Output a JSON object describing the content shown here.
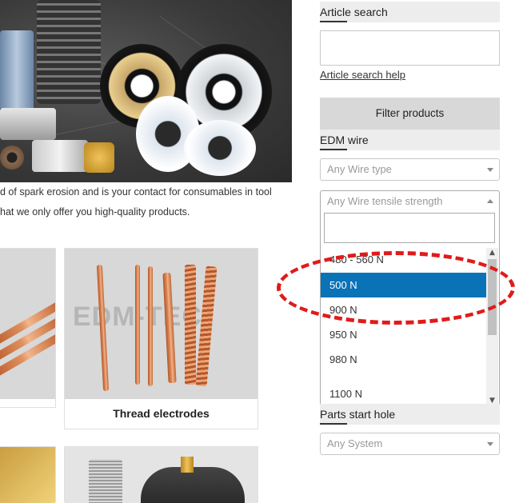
{
  "intro": {
    "line1": "d of spark erosion and is your contact for consumables in tool",
    "line2": "hat we only offer you high-quality products."
  },
  "cards": {
    "thread_electrodes": {
      "caption": "Thread electrodes",
      "watermark": "EDM-TEC"
    }
  },
  "sidebar": {
    "article_search": {
      "title": "Article search",
      "help_link": "Article search help"
    },
    "filter_button": "Filter products",
    "edm_wire": {
      "title": "EDM wire",
      "wire_type_placeholder": "Any Wire type",
      "tensile_placeholder": "Any Wire tensile strength",
      "options": [
        "480 - 560 N",
        "500 N",
        "900 N",
        "950 N",
        "980 N",
        "1100 N"
      ],
      "selected": "500 N"
    },
    "parts_start_hole": {
      "title": "Parts start hole",
      "system_placeholder": "Any System"
    }
  },
  "colors": {
    "selected_option_bg": "#0a73b7",
    "annotation_red": "#e01b1b",
    "section_title_bg": "#ededed"
  }
}
